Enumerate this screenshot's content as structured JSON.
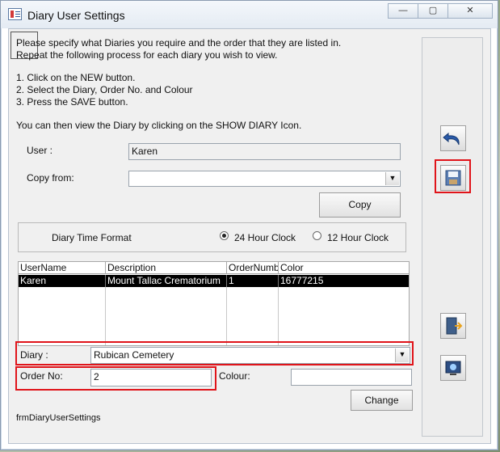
{
  "window": {
    "title": "Diary User Settings",
    "min_label": "—",
    "max_label": "▢",
    "close_label": "✕"
  },
  "instructions": {
    "line1": "Please specify what Diaries you require and the order that they are listed in.",
    "line2": "Repeat the following process for each diary you wish to view.",
    "step1": "1. Click on the NEW  button.",
    "step2": "2. Select the Diary, Order No. and Colour",
    "step3": "3. Press the SAVE button.",
    "note": "You can then view the Diary by clicking on the SHOW DIARY Icon."
  },
  "user": {
    "label": "User :",
    "value": "Karen"
  },
  "copy_from": {
    "label": "Copy from:",
    "value": ""
  },
  "copy_button": "Copy",
  "time_format": {
    "label": "Diary Time Format",
    "option_24": "24 Hour Clock",
    "option_12": "12 Hour Clock",
    "selected": "24 Hour Clock"
  },
  "grid": {
    "headers": [
      "UserName",
      "Description",
      "OrderNumb",
      "Color"
    ],
    "rows": [
      [
        "Karen",
        "Mount Tallac Crematorium",
        "1",
        "16777215"
      ]
    ]
  },
  "diary": {
    "label": "Diary :",
    "value": "Rubican Cemetery"
  },
  "order_no": {
    "label": "Order No:",
    "value": "2"
  },
  "colour": {
    "label": "Colour:",
    "value": ""
  },
  "change_button": "Change",
  "form_name": "frmDiaryUserSettings",
  "icons": [
    "undo-icon",
    "save-icon",
    "exit-icon",
    "show-diary-icon"
  ],
  "colors": {
    "highlight": "#e0141a",
    "grid_selected": "#000000"
  }
}
